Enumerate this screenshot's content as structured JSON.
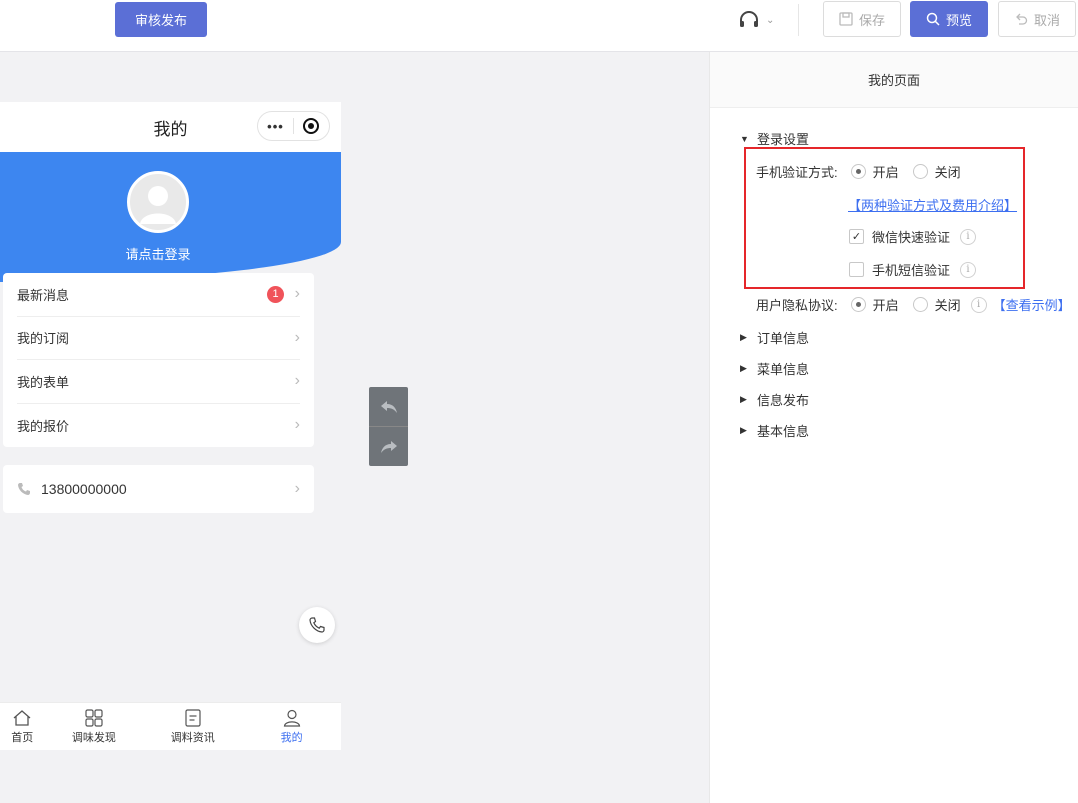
{
  "toolbar": {
    "publish_label": "审核发布",
    "save_label": "保存",
    "preview_label": "预览",
    "cancel_label": "取消"
  },
  "phone": {
    "title": "我的",
    "login_text": "请点击登录",
    "menu": [
      {
        "label": "最新消息",
        "badge": "1"
      },
      {
        "label": "我的订阅"
      },
      {
        "label": "我的表单"
      },
      {
        "label": "我的报价"
      }
    ],
    "phone_number": "13800000000",
    "tabs": [
      {
        "label": "首页",
        "icon": "home-icon"
      },
      {
        "label": "调味发现",
        "icon": "grid-icon"
      },
      {
        "label": "调料资讯",
        "icon": "document-icon"
      },
      {
        "label": "我的",
        "icon": "user-icon",
        "active": true
      }
    ]
  },
  "panel": {
    "header": "我的页面",
    "login_section": "登录设置",
    "phone_verify_label": "手机验证方式:",
    "on_label": "开启",
    "off_label": "关闭",
    "verify_link": "【两种验证方式及费用介绍】",
    "wechat_verify": "微信快速验证",
    "sms_verify": "手机短信验证",
    "privacy_label": "用户隐私协议:",
    "privacy_link": "【查看示例】",
    "sections": [
      "订单信息",
      "菜单信息",
      "信息发布",
      "基本信息"
    ]
  },
  "colors": {
    "accent": "#5b6fd6",
    "hero_blue": "#3d86f0",
    "highlight_red": "#e5262a"
  }
}
